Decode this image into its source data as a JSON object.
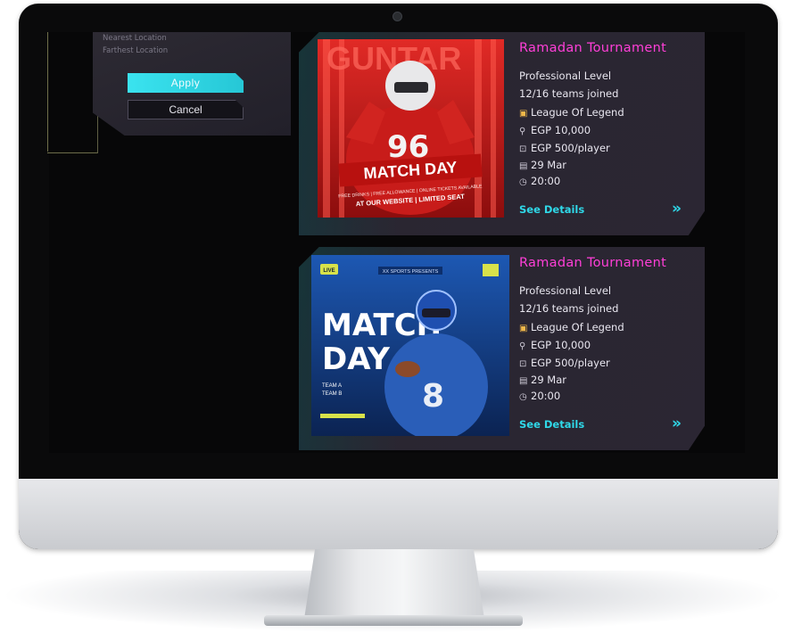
{
  "filter": {
    "options": [
      "Nearest Location",
      "Farthest Location"
    ],
    "apply_label": "Apply",
    "cancel_label": "Cancel"
  },
  "cards": [
    {
      "title": "Ramadan Tournament",
      "level": "Professional Level",
      "teams": "12/16 teams joined",
      "game": "League Of Legend",
      "prize": "EGP 10,000",
      "fee": "EGP 500/player",
      "date": "29 Mar",
      "time": "20:00",
      "details_label": "See Details",
      "poster": {
        "headline": "MATCH DAY",
        "jersey_number": "96",
        "tagline": "FREE DRINKS | FREE ALLOWANCE | ONLINE TICKETS AVAILABLE",
        "cta": "AT OUR WEBSITE | LIMITED SEAT",
        "colors": [
          "#d9221f",
          "#7a0b0b"
        ]
      }
    },
    {
      "title": "Ramadan Tournament",
      "level": "Professional Level",
      "teams": "12/16 teams joined",
      "game": "League Of Legend",
      "prize": "EGP 10,000",
      "fee": "EGP 500/player",
      "date": "29 Mar",
      "time": "20:00",
      "details_label": "See Details",
      "poster": {
        "headline_line1": "MATCH",
        "headline_line2": "DAY",
        "jersey_number": "8",
        "badge": "LIVE",
        "top_banner": "XX SPORTS PRESENTS",
        "team_a": "TEAM A",
        "team_b": "TEAM B",
        "colors": [
          "#143f86",
          "#0c2350"
        ]
      }
    }
  ],
  "icons": {
    "game": "controller-icon",
    "prize": "trophy-icon",
    "fee": "ticket-icon",
    "date": "calendar-icon",
    "time": "clock-icon",
    "details": "double-chevron-right-icon"
  },
  "accent_colors": {
    "title": "#ff3fd8",
    "cyan": "#2fd8e8"
  }
}
